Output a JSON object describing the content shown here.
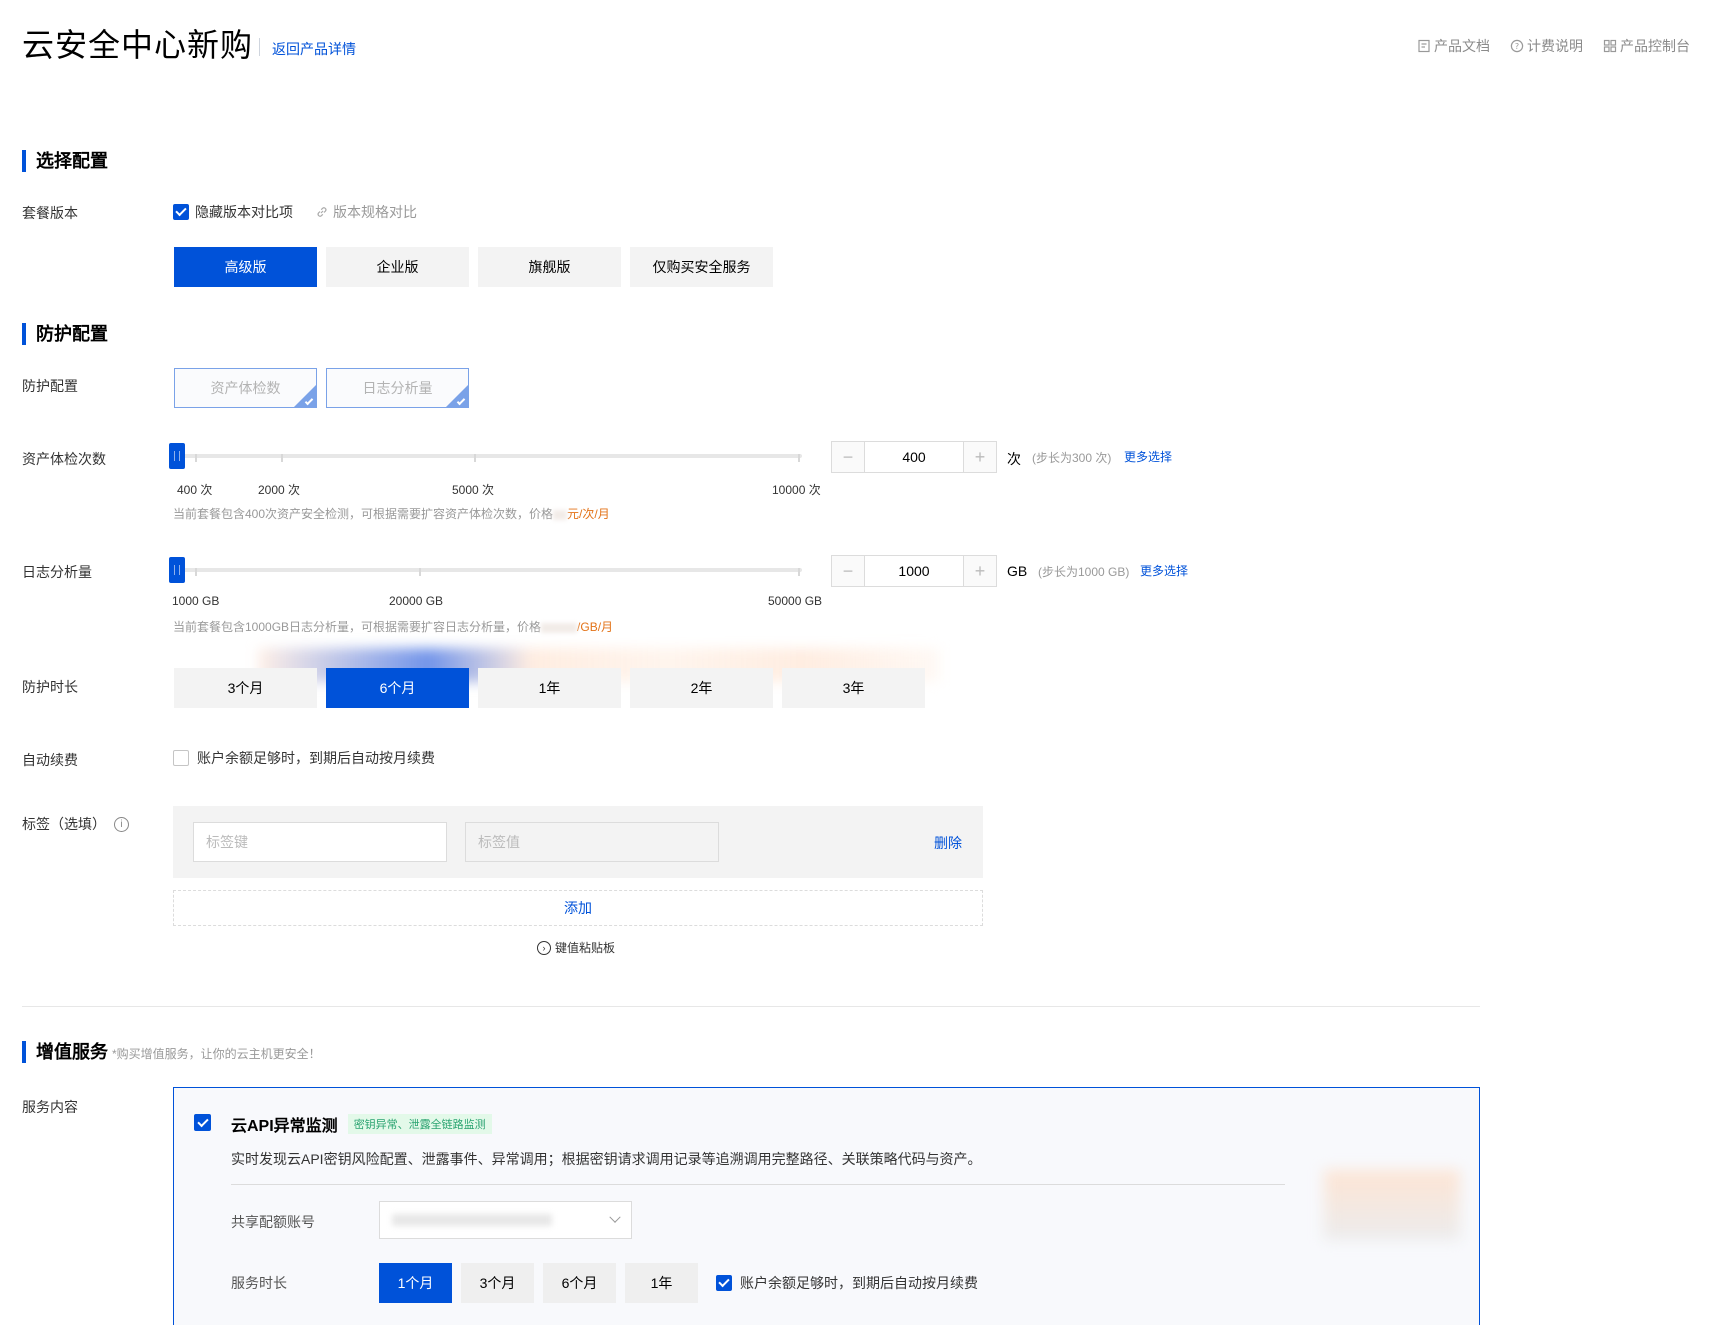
{
  "header": {
    "title": "云安全中心新购",
    "back_link": "返回产品详情",
    "links": [
      {
        "label": "产品文档",
        "icon": "doc-icon"
      },
      {
        "label": "计费说明",
        "icon": "help-circle-icon"
      },
      {
        "label": "产品控制台",
        "icon": "grid-icon"
      }
    ]
  },
  "select_config": {
    "heading": "选择配置",
    "package_label": "套餐版本",
    "hide_compare_label": "隐藏版本对比项",
    "hide_compare_checked": true,
    "spec_compare_label": "版本规格对比",
    "editions": [
      "高级版",
      "企业版",
      "旗舰版",
      "仅购买安全服务"
    ],
    "selected_edition": "高级版"
  },
  "protect_config": {
    "heading": "防护配置",
    "features_label": "防护配置",
    "features": [
      "资产体检数",
      "日志分析量"
    ],
    "asset_scan": {
      "label": "资产体检次数",
      "ticks": [
        "400 次",
        "2000 次",
        "5000 次",
        "10000 次"
      ],
      "hint_text": "当前套餐包含400次资产安全检测，可根据需要扩容资产体检次数，价格",
      "hint_price": "元/次/月",
      "minus": "−",
      "value": "400",
      "plus": "+",
      "unit": "次",
      "step_note": "(步长为300 次)",
      "more": "更多选择",
      "value_fraction": 0
    },
    "log_analysis": {
      "label": "日志分析量",
      "ticks": [
        "1000 GB",
        "20000 GB",
        "50000 GB"
      ],
      "hint_text": "当前套餐包含1000GB日志分析量，可根据需要扩容日志分析量，价格",
      "hint_price": "/GB/月",
      "minus": "−",
      "value": "1000",
      "plus": "+",
      "unit": "GB",
      "step_note": "(步长为1000 GB)",
      "more": "更多选择",
      "value_fraction": 0
    },
    "duration_label": "防护时长",
    "durations": [
      "3个月",
      "6个月",
      "1年",
      "2年",
      "3年"
    ],
    "selected_duration": "6个月",
    "auto_renew_label": "自动续费",
    "auto_renew_text": "账户余额足够时，到期后自动按月续费",
    "auto_renew_checked": false,
    "tags_label": "标签（选填）",
    "tag_key_placeholder": "标签键",
    "tag_value_placeholder": "标签值",
    "delete": "删除",
    "add": "添加",
    "clipboard": "键值粘贴板"
  },
  "value_added": {
    "heading": "增值服务",
    "note": "*购买增值服务，让你的云主机更安全！",
    "content_label": "服务内容",
    "service": {
      "checked": true,
      "title": "云API异常监测",
      "badge": "密钥异常、泄露全链路监测",
      "description": "实时发现云API密钥风险配置、泄露事件、异常调用；根据密钥请求调用记录等追溯调用完整路径、关联策略代码与资产。",
      "account_label": "共享配额账号",
      "duration_label": "服务时长",
      "durations": [
        "1个月",
        "3个月",
        "6个月",
        "1年"
      ],
      "selected_duration": "1个月",
      "auto_renew_text": "账户余额足够时，到期后自动按月续费",
      "auto_renew_checked": true
    }
  },
  "colors": {
    "primary": "#0052d9",
    "price": "#e37318",
    "badge_green": "#2ba471"
  }
}
